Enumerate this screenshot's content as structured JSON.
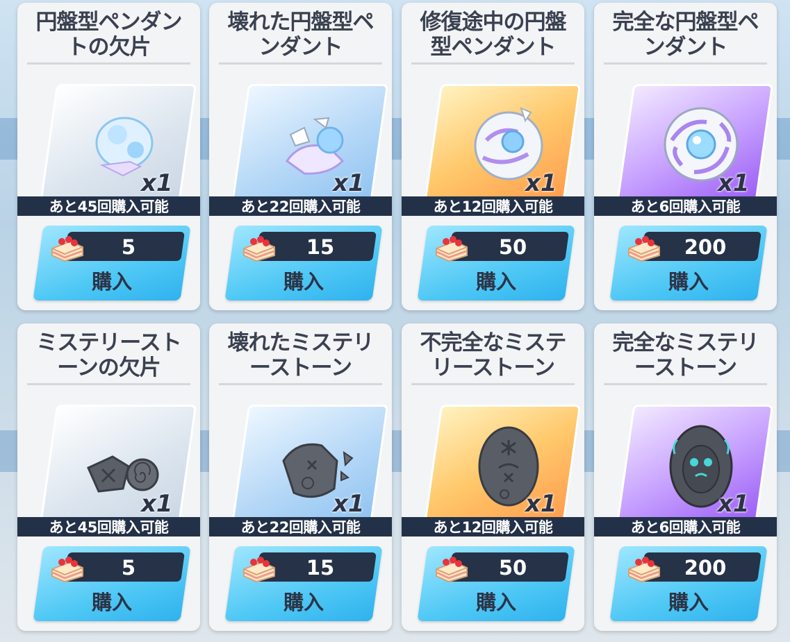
{
  "shop": {
    "buy_label": "購入",
    "currency_icon": "cake-icon",
    "colors": {
      "limit_bar": "#233148",
      "price_bar": "#253247",
      "button": "#4fc8f5"
    },
    "items": [
      {
        "name": "円盤型ペンダントの欠片",
        "qty": "x1",
        "limit": "あと45回購入可能",
        "price": "5",
        "tier": "blue",
        "icon": "disc-pendant-fragment-icon"
      },
      {
        "name": "壊れた円盤型ペンダント",
        "qty": "x1",
        "limit": "あと22回購入可能",
        "price": "15",
        "tier": "lightblue",
        "icon": "broken-disc-pendant-icon"
      },
      {
        "name": "修復途中の円盤型ペンダント",
        "qty": "x1",
        "limit": "あと12回購入可能",
        "price": "50",
        "tier": "gold",
        "icon": "repairing-disc-pendant-icon"
      },
      {
        "name": "完全な円盤型ペンダント",
        "qty": "x1",
        "limit": "あと6回購入可能",
        "price": "200",
        "tier": "purple",
        "icon": "complete-disc-pendant-icon"
      },
      {
        "name": "ミステリーストーンの欠片",
        "qty": "x1",
        "limit": "あと45回購入可能",
        "price": "5",
        "tier": "blue",
        "icon": "mystery-stone-fragment-icon"
      },
      {
        "name": "壊れたミステリーストーン",
        "qty": "x1",
        "limit": "あと22回購入可能",
        "price": "15",
        "tier": "lightblue",
        "icon": "broken-mystery-stone-icon"
      },
      {
        "name": "不完全なミステリーストーン",
        "qty": "x1",
        "limit": "あと12回購入可能",
        "price": "50",
        "tier": "gold",
        "icon": "incomplete-mystery-stone-icon"
      },
      {
        "name": "完全なミステリーストーン",
        "qty": "x1",
        "limit": "あと6回購入可能",
        "price": "200",
        "tier": "purple",
        "icon": "complete-mystery-stone-icon"
      }
    ]
  }
}
